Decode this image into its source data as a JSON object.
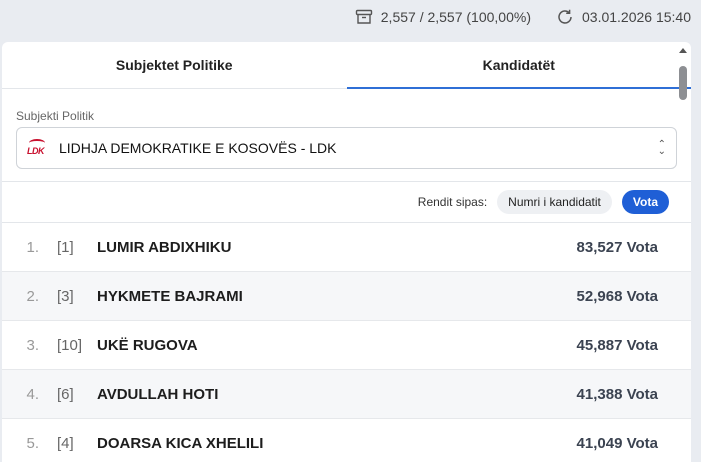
{
  "topbar": {
    "counts": "2,557 / 2,557 (100,00%)",
    "updated": "03.01.2026 15:40",
    "archive_icon": "archive-box-icon",
    "refresh_icon": "refresh-icon"
  },
  "tabs": [
    {
      "label": "Subjektet Politike",
      "active": false
    },
    {
      "label": "Kandidatët",
      "active": true
    }
  ],
  "select": {
    "label": "Subjekti Politik",
    "logo_text": "LDK",
    "value": "LIDHJA DEMOKRATIKE E KOSOVËS - LDK"
  },
  "sort": {
    "label": "Rendit sipas:",
    "options": [
      "Numri i kandidatit",
      "Vota"
    ],
    "selected": "Vota"
  },
  "candidates": [
    {
      "rank": "1.",
      "number": "[1]",
      "name": "LUMIR ABDIXHIKU",
      "votes": "83,527 Vota"
    },
    {
      "rank": "2.",
      "number": "[3]",
      "name": "HYKMETE BAJRAMI",
      "votes": "52,968 Vota"
    },
    {
      "rank": "3.",
      "number": "[10]",
      "name": "UKË RUGOVA",
      "votes": "45,887 Vota"
    },
    {
      "rank": "4.",
      "number": "[6]",
      "name": "AVDULLAH HOTI",
      "votes": "41,388 Vota"
    },
    {
      "rank": "5.",
      "number": "[4]",
      "name": "DOARSA KICA XHELILI",
      "votes": "41,049 Vota"
    }
  ],
  "colors": {
    "accent": "#1f5fd6",
    "tab_underline": "#2f6fd6",
    "ldk_red": "#c8102e"
  }
}
